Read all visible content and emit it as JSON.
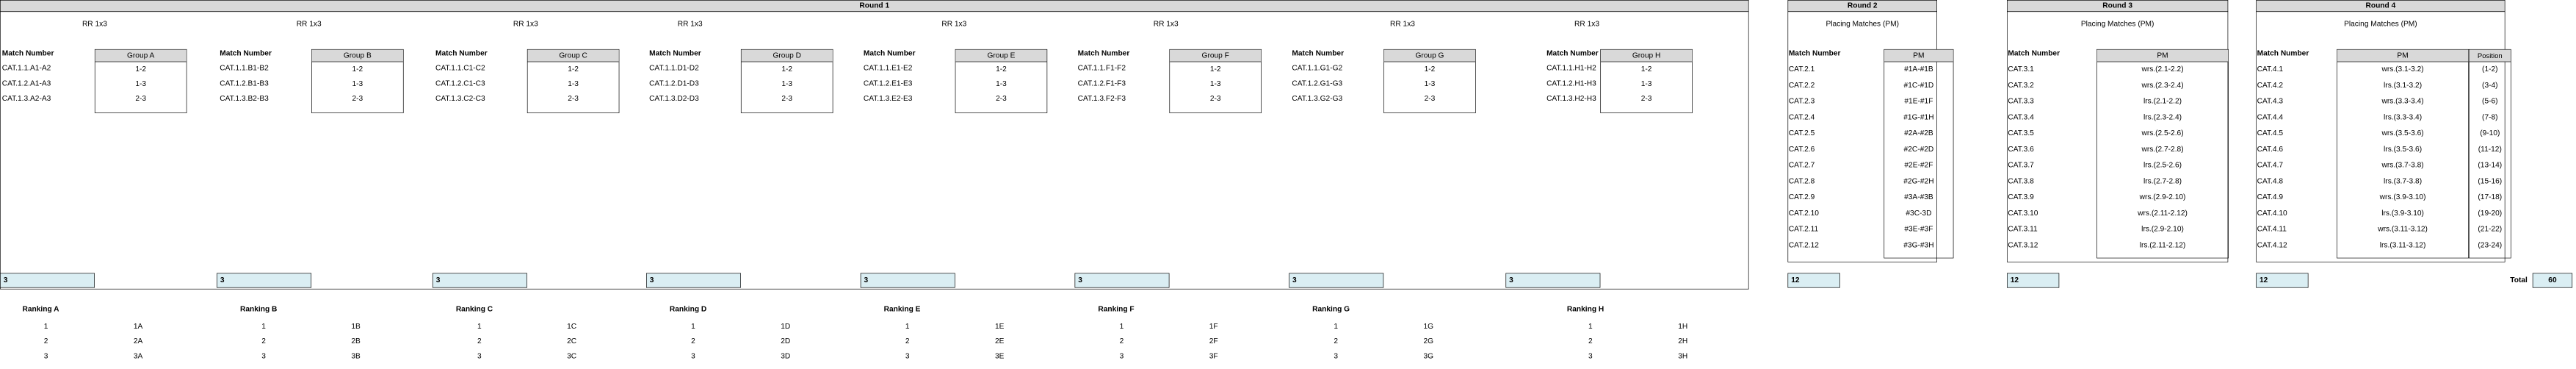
{
  "round1": {
    "title": "Round 1",
    "subtitle": "RR 1x3",
    "match_number_label": "Match Number",
    "groups": [
      {
        "name": "Group A",
        "matches": [
          "CAT.1.1.A1-A2",
          "CAT.1.2.A1-A3",
          "CAT.1.3.A2-A3"
        ],
        "pairs": [
          "1-2",
          "1-3",
          "2-3"
        ],
        "count": "3",
        "ranking_title": "Ranking A",
        "ranking": [
          {
            "pos": "1",
            "code": "1A"
          },
          {
            "pos": "2",
            "code": "2A"
          },
          {
            "pos": "3",
            "code": "3A"
          }
        ]
      },
      {
        "name": "Group B",
        "matches": [
          "CAT.1.1.B1-B2",
          "CAT.1.2.B1-B3",
          "CAT.1.3.B2-B3"
        ],
        "pairs": [
          "1-2",
          "1-3",
          "2-3"
        ],
        "count": "3",
        "ranking_title": "Ranking B",
        "ranking": [
          {
            "pos": "1",
            "code": "1B"
          },
          {
            "pos": "2",
            "code": "2B"
          },
          {
            "pos": "3",
            "code": "3B"
          }
        ]
      },
      {
        "name": "Group C",
        "matches": [
          "CAT.1.1.C1-C2",
          "CAT.1.2.C1-C3",
          "CAT.1.3.C2-C3"
        ],
        "pairs": [
          "1-2",
          "1-3",
          "2-3"
        ],
        "count": "3",
        "ranking_title": "Ranking C",
        "ranking": [
          {
            "pos": "1",
            "code": "1C"
          },
          {
            "pos": "2",
            "code": "2C"
          },
          {
            "pos": "3",
            "code": "3C"
          }
        ]
      },
      {
        "name": "Group D",
        "matches": [
          "CAT.1.1.D1-D2",
          "CAT.1.2.D1-D3",
          "CAT.1.3.D2-D3"
        ],
        "pairs": [
          "1-2",
          "1-3",
          "2-3"
        ],
        "count": "3",
        "ranking_title": "Ranking D",
        "ranking": [
          {
            "pos": "1",
            "code": "1D"
          },
          {
            "pos": "2",
            "code": "2D"
          },
          {
            "pos": "3",
            "code": "3D"
          }
        ]
      },
      {
        "name": "Group E",
        "matches": [
          "CAT.1.1.E1-E2",
          "CAT.1.2.E1-E3",
          "CAT.1.3.E2-E3"
        ],
        "pairs": [
          "1-2",
          "1-3",
          "2-3"
        ],
        "count": "3",
        "ranking_title": "Ranking E",
        "ranking": [
          {
            "pos": "1",
            "code": "1E"
          },
          {
            "pos": "2",
            "code": "2E"
          },
          {
            "pos": "3",
            "code": "3E"
          }
        ]
      },
      {
        "name": "Group F",
        "matches": [
          "CAT.1.1.F1-F2",
          "CAT.1.2.F1-F3",
          "CAT.1.3.F2-F3"
        ],
        "pairs": [
          "1-2",
          "1-3",
          "2-3"
        ],
        "count": "3",
        "ranking_title": "Ranking F",
        "ranking": [
          {
            "pos": "1",
            "code": "1F"
          },
          {
            "pos": "2",
            "code": "2F"
          },
          {
            "pos": "3",
            "code": "3F"
          }
        ]
      },
      {
        "name": "Group G",
        "matches": [
          "CAT.1.1.G1-G2",
          "CAT.1.2.G1-G3",
          "CAT.1.3.G2-G3"
        ],
        "pairs": [
          "1-2",
          "1-3",
          "2-3"
        ],
        "count": "3",
        "ranking_title": "Ranking G",
        "ranking": [
          {
            "pos": "1",
            "code": "1G"
          },
          {
            "pos": "2",
            "code": "2G"
          },
          {
            "pos": "3",
            "code": "3G"
          }
        ]
      },
      {
        "name": "Group H",
        "matches": [
          "CAT.1.1.H1-H2",
          "CAT.1.2.H1-H3",
          "CAT.1.3.H2-H3"
        ],
        "pairs": [
          "1-2",
          "1-3",
          "2-3"
        ],
        "count": "3",
        "ranking_title": "Ranking H",
        "ranking": [
          {
            "pos": "1",
            "code": "1H"
          },
          {
            "pos": "2",
            "code": "2H"
          },
          {
            "pos": "3",
            "code": "3H"
          }
        ]
      }
    ]
  },
  "round2": {
    "title": "Round 2",
    "subtitle": "Placing Matches (PM)",
    "match_number_label": "Match Number",
    "pm_label": "PM",
    "rows": [
      {
        "match": "CAT.2.1",
        "pm": "#1A-#1B"
      },
      {
        "match": "CAT.2.2",
        "pm": "#1C-#1D"
      },
      {
        "match": "CAT.2.3",
        "pm": "#1E-#1F"
      },
      {
        "match": "CAT.2.4",
        "pm": "#1G-#1H"
      },
      {
        "match": "CAT.2.5",
        "pm": "#2A-#2B"
      },
      {
        "match": "CAT.2.6",
        "pm": "#2C-#2D"
      },
      {
        "match": "CAT.2.7",
        "pm": "#2E-#2F"
      },
      {
        "match": "CAT.2.8",
        "pm": "#2G-#2H"
      },
      {
        "match": "CAT.2.9",
        "pm": "#3A-#3B"
      },
      {
        "match": "CAT.2.10",
        "pm": "#3C-3D"
      },
      {
        "match": "CAT.2.11",
        "pm": "#3E-#3F"
      },
      {
        "match": "CAT.2.12",
        "pm": "#3G-#3H"
      }
    ],
    "count": "12"
  },
  "round3": {
    "title": "Round 3",
    "subtitle": "Placing Matches (PM)",
    "match_number_label": "Match Number",
    "pm_label": "PM",
    "rows": [
      {
        "match": "CAT.3.1",
        "pm": "wrs.(2.1-2.2)"
      },
      {
        "match": "CAT.3.2",
        "pm": "wrs.(2.3-2.4)"
      },
      {
        "match": "CAT.3.3",
        "pm": "lrs.(2.1-2.2)"
      },
      {
        "match": "CAT.3.4",
        "pm": "lrs.(2.3-2.4)"
      },
      {
        "match": "CAT.3.5",
        "pm": "wrs.(2.5-2.6)"
      },
      {
        "match": "CAT.3.6",
        "pm": "wrs.(2.7-2.8)"
      },
      {
        "match": "CAT.3.7",
        "pm": "lrs.(2.5-2.6)"
      },
      {
        "match": "CAT.3.8",
        "pm": "lrs.(2.7-2.8)"
      },
      {
        "match": "CAT.3.9",
        "pm": "wrs.(2.9-2.10)"
      },
      {
        "match": "CAT.3.10",
        "pm": "wrs.(2.11-2.12)"
      },
      {
        "match": "CAT.3.11",
        "pm": "lrs.(2.9-2.10)"
      },
      {
        "match": "CAT.3.12",
        "pm": "lrs.(2.11-2.12)"
      }
    ],
    "count": "12"
  },
  "round4": {
    "title": "Round 4",
    "subtitle": "Placing Matches (PM)",
    "match_number_label": "Match Number",
    "pm_label": "PM",
    "position_label": "Position",
    "rows": [
      {
        "match": "CAT.4.1",
        "pm": "wrs.(3.1-3.2)",
        "pos": "(1-2)"
      },
      {
        "match": "CAT.4.2",
        "pm": "lrs.(3.1-3.2)",
        "pos": "(3-4)"
      },
      {
        "match": "CAT.4.3",
        "pm": "wrs.(3.3-3.4)",
        "pos": "(5-6)"
      },
      {
        "match": "CAT.4.4",
        "pm": "lrs.(3.3-3.4)",
        "pos": "(7-8)"
      },
      {
        "match": "CAT.4.5",
        "pm": "wrs.(3.5-3.6)",
        "pos": "(9-10)"
      },
      {
        "match": "CAT.4.6",
        "pm": "lrs.(3.5-3.6)",
        "pos": "(11-12)"
      },
      {
        "match": "CAT.4.7",
        "pm": "wrs.(3.7-3.8)",
        "pos": "(13-14)"
      },
      {
        "match": "CAT.4.8",
        "pm": "lrs.(3.7-3.8)",
        "pos": "(15-16)"
      },
      {
        "match": "CAT.4.9",
        "pm": "wrs.(3.9-3.10)",
        "pos": "(17-18)"
      },
      {
        "match": "CAT.4.10",
        "pm": "lrs.(3.9-3.10)",
        "pos": "(19-20)"
      },
      {
        "match": "CAT.4.11",
        "pm": "wrs.(3.11-3.12)",
        "pos": "(21-22)"
      },
      {
        "match": "CAT.4.12",
        "pm": "lrs.(3.11-3.12)",
        "pos": "(23-24)"
      }
    ],
    "count": "12"
  },
  "total": {
    "label": "Total",
    "value": "60"
  },
  "colors": {
    "header_fill": "#d9d9d9",
    "count_fill": "#daeef3"
  }
}
